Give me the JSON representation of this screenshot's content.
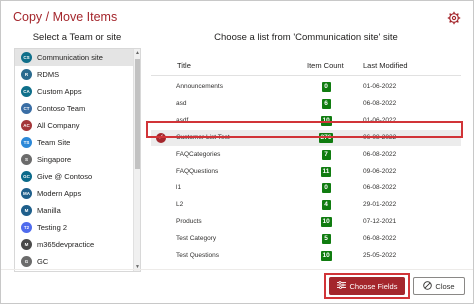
{
  "window": {
    "title": "Copy / Move Items",
    "settings_icon": "gear-icon"
  },
  "left_panel": {
    "heading": "Select a Team or site",
    "sites": [
      {
        "initials": "CS",
        "name": "Communication site",
        "color": "#0f6f8a",
        "selected": true
      },
      {
        "initials": "R",
        "name": "RDMS",
        "color": "#2a6a8e",
        "selected": false
      },
      {
        "initials": "CA",
        "name": "Custom Apps",
        "color": "#0f6f8a",
        "selected": false
      },
      {
        "initials": "CT",
        "name": "Contoso Team",
        "color": "#3a6ea5",
        "selected": false
      },
      {
        "initials": "AC",
        "name": "All Company",
        "color": "#a4373a",
        "selected": false
      },
      {
        "initials": "TS",
        "name": "Team Site",
        "color": "#2b88d8",
        "selected": false
      },
      {
        "initials": "S",
        "name": "Singapore",
        "color": "#6b6b6b",
        "selected": false
      },
      {
        "initials": "GC",
        "name": "Give @ Contoso",
        "color": "#0b6a8a",
        "selected": false
      },
      {
        "initials": "MA",
        "name": "Modern Apps",
        "color": "#1f5f8b",
        "selected": false
      },
      {
        "initials": "M",
        "name": "Manilla",
        "color": "#1f5f8b",
        "selected": false
      },
      {
        "initials": "T2",
        "name": "Testing 2",
        "color": "#4f6bed",
        "selected": false
      },
      {
        "initials": "M",
        "name": "m365devpractice",
        "color": "#4a4a4a",
        "selected": false
      },
      {
        "initials": "G",
        "name": "GC",
        "color": "#6b6b6b",
        "selected": false
      }
    ]
  },
  "right_panel": {
    "heading": "Choose a list from 'Communication site' site",
    "columns": {
      "title": "Title",
      "count": "Item Count",
      "modified": "Last Modified"
    },
    "rows": [
      {
        "title": "Announcements",
        "count": "0",
        "modified": "01-06-2022",
        "selected": false
      },
      {
        "title": "asd",
        "count": "6",
        "modified": "06-08-2022",
        "selected": false
      },
      {
        "title": "asdf",
        "count": "10",
        "modified": "01-06-2022",
        "selected": false
      },
      {
        "title": "Customer List Test",
        "count": "276",
        "modified": "06-08-2022",
        "selected": true
      },
      {
        "title": "FAQCategories",
        "count": "7",
        "modified": "06-08-2022",
        "selected": false
      },
      {
        "title": "FAQQuestions",
        "count": "11",
        "modified": "09-06-2022",
        "selected": false
      },
      {
        "title": "l1",
        "count": "0",
        "modified": "06-08-2022",
        "selected": false
      },
      {
        "title": "L2",
        "count": "4",
        "modified": "29-01-2022",
        "selected": false
      },
      {
        "title": "Products",
        "count": "10",
        "modified": "07-12-2021",
        "selected": false
      },
      {
        "title": "Test Category",
        "count": "5",
        "modified": "06-08-2022",
        "selected": false
      },
      {
        "title": "Test Questions",
        "count": "10",
        "modified": "25-05-2022",
        "selected": false
      }
    ]
  },
  "footer": {
    "choose_fields_label": "Choose Fields",
    "close_label": "Close"
  },
  "colors": {
    "accent": "#a4262c",
    "count_badge": "#107c10",
    "highlight": "#d13438"
  }
}
